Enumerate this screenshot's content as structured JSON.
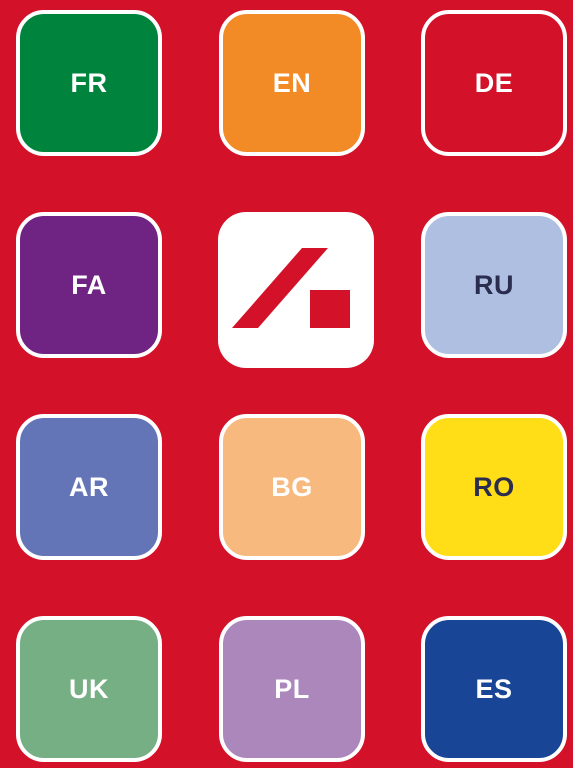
{
  "background_color": "#d31128",
  "tiles": [
    {
      "code": "FR",
      "bg": "#00843d",
      "fg": "#ffffff"
    },
    {
      "code": "EN",
      "bg": "#f28a26",
      "fg": "#ffffff"
    },
    {
      "code": "DE",
      "bg": "#d31128",
      "fg": "#ffffff"
    },
    {
      "code": "FA",
      "bg": "#6f2383",
      "fg": "#ffffff"
    },
    {
      "code": "RU",
      "bg": "#aebfe1",
      "fg": "#2b2d4f"
    },
    {
      "code": "AR",
      "bg": "#6475b7",
      "fg": "#ffffff"
    },
    {
      "code": "BG",
      "bg": "#f7b97e",
      "fg": "#ffffff"
    },
    {
      "code": "RO",
      "bg": "#ffde17",
      "fg": "#2b2d4f"
    },
    {
      "code": "UK",
      "bg": "#77af84",
      "fg": "#ffffff"
    },
    {
      "code": "PL",
      "bg": "#ab87bc",
      "fg": "#ffffff"
    },
    {
      "code": "ES",
      "bg": "#184596",
      "fg": "#ffffff"
    }
  ],
  "logo": {
    "icon": "app-logo-icon",
    "color": "#d31128"
  }
}
